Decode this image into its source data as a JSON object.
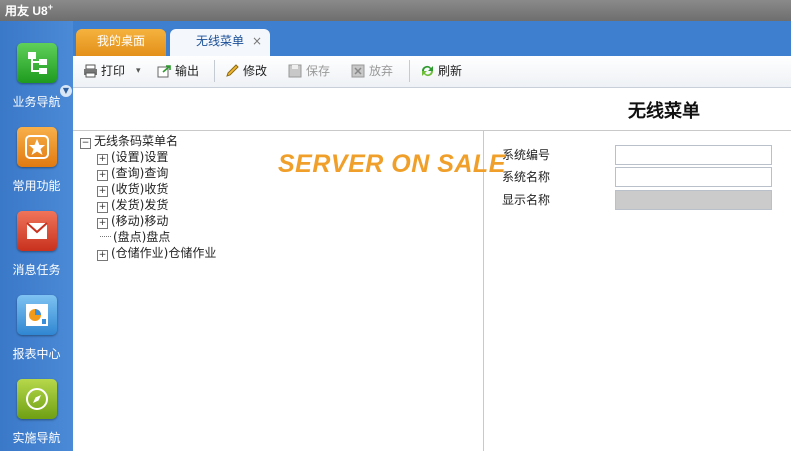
{
  "app": {
    "brand": "用友 U8",
    "brand_sup": "+"
  },
  "nav": [
    {
      "label": "业务导航",
      "icon": "business-navigation-icon"
    },
    {
      "label": "常用功能",
      "icon": "favorites-star-icon"
    },
    {
      "label": "消息任务",
      "icon": "message-envelope-icon"
    },
    {
      "label": "报表中心",
      "icon": "report-chart-icon"
    },
    {
      "label": "实施导航",
      "icon": "compass-icon"
    }
  ],
  "tabs": [
    {
      "label": "我的桌面"
    },
    {
      "label": "无线菜单",
      "close": "×"
    }
  ],
  "toolbar": {
    "print": "打印",
    "print_dropdown": "▾",
    "export": "输出",
    "edit": "修改",
    "save": "保存",
    "discard": "放弃",
    "refresh": "刷新"
  },
  "page": {
    "title": "无线菜单"
  },
  "watermark": "SERVER ON SALE",
  "tree": {
    "root": "无线条码菜单名",
    "children": [
      {
        "label": "(设置)设置",
        "expandable": true
      },
      {
        "label": "(查询)查询",
        "expandable": true
      },
      {
        "label": "(收货)收货",
        "expandable": true
      },
      {
        "label": "(发货)发货",
        "expandable": true
      },
      {
        "label": "(移动)移动",
        "expandable": true
      },
      {
        "label": "(盘点)盘点",
        "expandable": false
      },
      {
        "label": "(仓储作业)仓储作业",
        "expandable": true
      }
    ],
    "expand_symbol": "+",
    "collapse_symbol": "−"
  },
  "form": {
    "fields": [
      {
        "label": "系统编号",
        "value": ""
      },
      {
        "label": "系统名称",
        "value": ""
      },
      {
        "label": "显示名称",
        "value": ""
      }
    ]
  }
}
